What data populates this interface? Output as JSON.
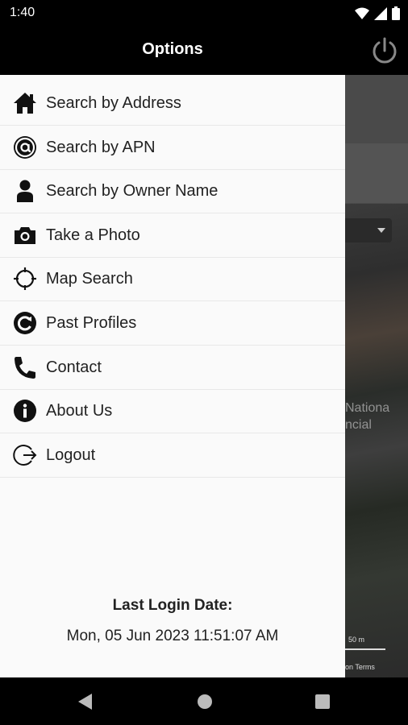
{
  "status_bar": {
    "time": "1:40"
  },
  "app_bar": {
    "title": "Options"
  },
  "menu": {
    "items": [
      {
        "label": "Search by Address",
        "icon": "home-icon"
      },
      {
        "label": "Search by APN",
        "icon": "at-icon"
      },
      {
        "label": "Search by Owner Name",
        "icon": "person-icon"
      },
      {
        "label": "Take a Photo",
        "icon": "camera-icon"
      },
      {
        "label": "Map Search",
        "icon": "crosshair-icon"
      },
      {
        "label": "Past Profiles",
        "icon": "history-icon"
      },
      {
        "label": "Contact",
        "icon": "phone-icon"
      },
      {
        "label": "About Us",
        "icon": "info-icon"
      },
      {
        "label": "Logout",
        "icon": "logout-icon"
      }
    ]
  },
  "login": {
    "label": "Last Login Date:",
    "value": "Mon, 05 Jun 2023 11:51:07 AM"
  },
  "map": {
    "text1": "Nationa",
    "text2": "ncial",
    "scale": "50 m",
    "attribution": "on  Terms"
  }
}
